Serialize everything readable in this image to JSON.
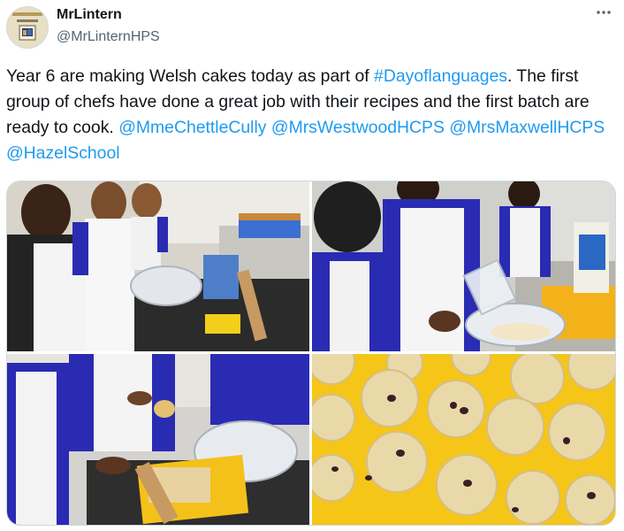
{
  "author": {
    "display_name": "MrLintern",
    "handle": "@MrLinternHPS",
    "avatar_icon": "profile-photo-icon"
  },
  "more_icon": "more-options-icon",
  "tweet": {
    "text_1": "Year 6 are making Welsh cakes today as part of ",
    "hashtag": "#Dayoflanguages",
    "text_2": ". The first group of chefs have done a great job with their recipes and the first batch are ready to cook. ",
    "mentions": [
      "@MmeChettleCully",
      "@MrsWestwoodHCPS",
      "@MrsMaxwellHCPS",
      "@HazelSchool"
    ]
  },
  "media": {
    "count": 4,
    "photos": [
      {
        "name": "photo-children-thumbs-up"
      },
      {
        "name": "photo-pupils-mixing-bowl"
      },
      {
        "name": "photo-rolling-dough"
      },
      {
        "name": "photo-welsh-cakes-on-board"
      }
    ]
  },
  "colors": {
    "link": "#1d9bf0",
    "text": "#0f1419",
    "secondary": "#536471",
    "border": "#cfd9de",
    "board_yellow": "#f5c518",
    "uniform_blue": "#2a2bb3"
  }
}
